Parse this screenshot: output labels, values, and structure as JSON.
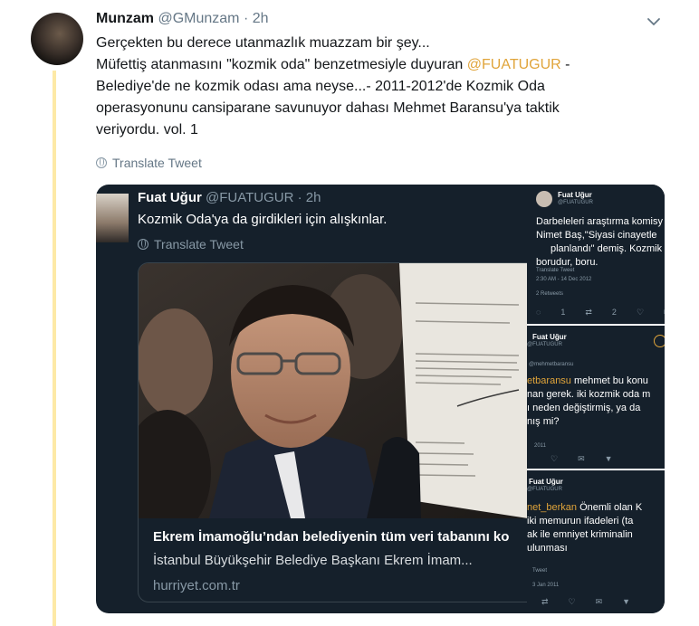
{
  "tweet": {
    "author_name": "Munzam",
    "author_handle": "@GMunzam",
    "time": "· 2h",
    "lines": {
      "l1": "Gerçekten bu derece utanmazlık muazzam bir şey...",
      "l2_pre": "Müfettiş atanmasını \"kozmik oda\" benzetmesiyle duyuran ",
      "mention": "@FUATUGUR",
      "l2_post": " -",
      "l3": "Belediye'de ne kozmik odası ama neyse...- 2011-2012'de Kozmik Oda",
      "l4": "operasyonunu cansiparane savunuyor dahası Mehmet Baransu'ya taktik",
      "l5": "veriyordu. vol. 1"
    },
    "translate_label": "Translate Tweet"
  },
  "quoted": {
    "author_name": "Fuat Uğur",
    "author_handle": "@FUATUGUR",
    "time": "· 2h",
    "text": "Kozmik Oda'ya da girdikleri için alışkınlar.",
    "translate_label": "Translate Tweet",
    "card": {
      "title": "Ekrem İmamoğlu’ndan belediyenin tüm veri tabanını ko",
      "description": "İstanbul Büyükşehir Belediye Başkanı Ekrem İmam...",
      "domain": "hurriyet.com.tr"
    }
  },
  "screenshots": {
    "s1": {
      "name": "Fuat Uğur",
      "handle": "@FUATUGUR",
      "l1": "Darbeleleri araştırma komisy",
      "l2": "Nimet Baş,\"Siyasi cinayetle",
      "l3": "planlandı\" demiş. Kozmik o",
      "l4": "borudur, boru.",
      "translate": "Translate Tweet",
      "date": "2:30 AM - 14 Dec 2012",
      "retweets": "2 Retweets",
      "counts": [
        "1",
        "2"
      ]
    },
    "s2": {
      "name": "Fuat Uğur",
      "handle": "@FUATUGUR",
      "mention": "etbaransu",
      "l1": "@mehmetbaransu",
      "l1b": "etbaransu mehmet bu konu",
      "l2": "nan gerek. iki kozmik oda m",
      "l3": "ı neden değiştirmiş, ya da",
      "l4": "nış mi?",
      "date": "2011"
    },
    "s3": {
      "name": "Fuat Uğur",
      "handle": "@FUATUGUR",
      "mention": "net_berkan",
      "l1": "net_berkan Önemli olan K",
      "l2": "iki memurun ifadeleri (ta",
      "l3": "ak ile emniyet kriminalin",
      "l4": "ulunması",
      "translate": "Tweet",
      "date": "3 Jan 2011"
    }
  },
  "colors": {
    "mention": "#e0a43a",
    "quote_bg": "#15202b",
    "thread_line": "#fde9a6"
  }
}
